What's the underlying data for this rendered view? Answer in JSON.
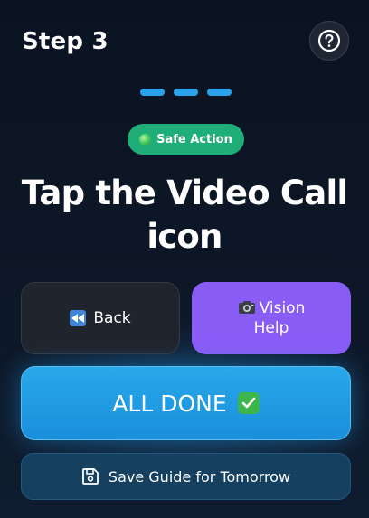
{
  "header": {
    "step_label": "Step 3",
    "help_icon": "question-circle-icon"
  },
  "progress": {
    "total_steps": 3,
    "color": "#2aa3ea"
  },
  "badge": {
    "label": "Safe Action",
    "color": "#1fae78"
  },
  "instruction": {
    "title": "Tap the Video Call icon"
  },
  "buttons": {
    "back_label": "Back",
    "back_icon": "rewind-icon",
    "vision_label_line1": "Vision",
    "vision_label_line2": "Help",
    "vision_icon": "camera-icon",
    "vision_color": "#8a5cf6",
    "done_label": "ALL DONE",
    "done_icon": "check-mark-icon",
    "done_color": "#1a9ae2",
    "save_label": "Save Guide for Tomorrow",
    "save_icon": "floppy-disk-icon"
  }
}
